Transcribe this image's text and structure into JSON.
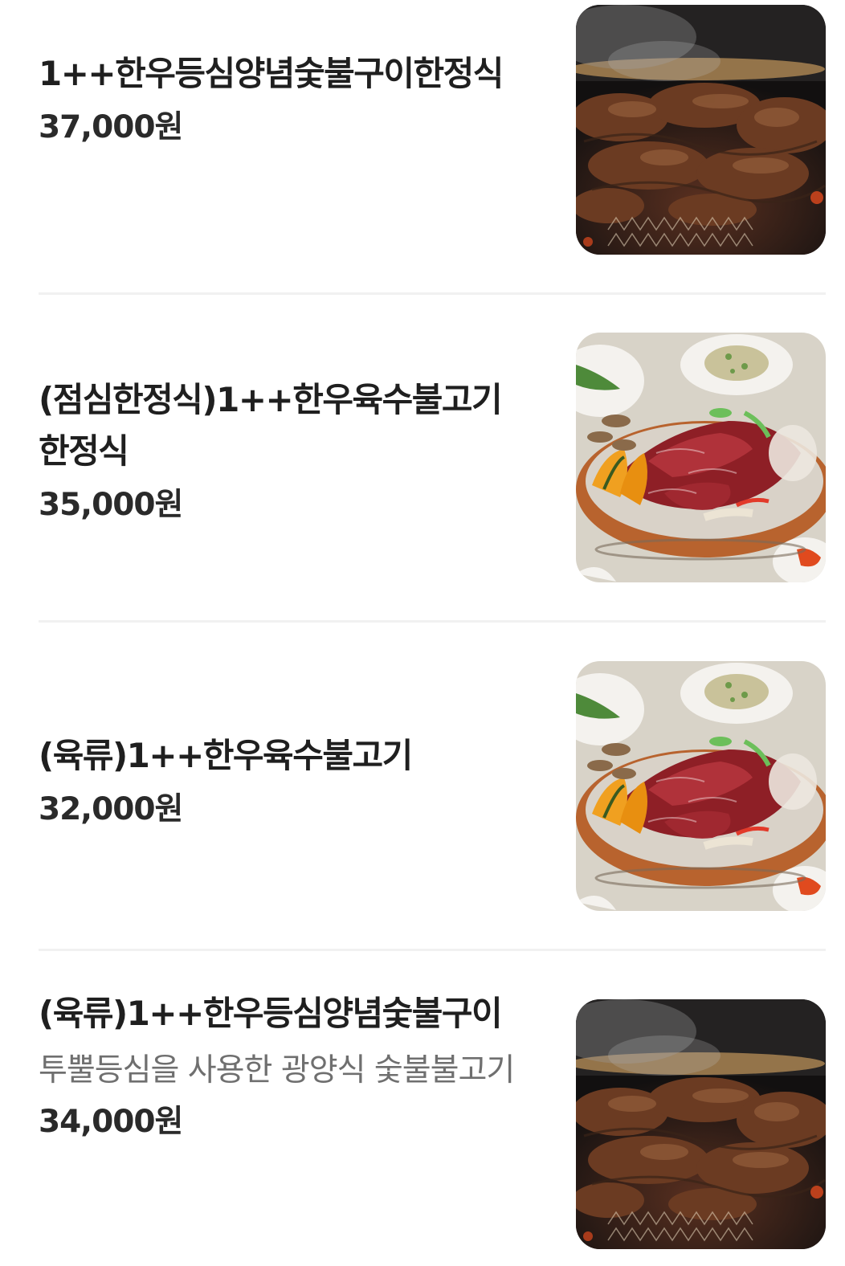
{
  "menu": {
    "items": [
      {
        "name": "1++한우등심양념숯불구이한정식",
        "description": "",
        "price": "37,000원",
        "photo": "grilled-beef-photo"
      },
      {
        "name": "(점심한정식)1++한우육수불고기한정식",
        "description": "",
        "price": "35,000원",
        "photo": "bulgogi-hotpot-photo"
      },
      {
        "name": "(육류)1++한우육수불고기",
        "description": "",
        "price": "32,000원",
        "photo": "bulgogi-hotpot-photo"
      },
      {
        "name": "(육류)1++한우등심양념숯불구이",
        "description": "투뿔등심을 사용한 광양식 숯불불고기",
        "price": "34,000원",
        "photo": "grilled-beef-photo"
      }
    ]
  }
}
